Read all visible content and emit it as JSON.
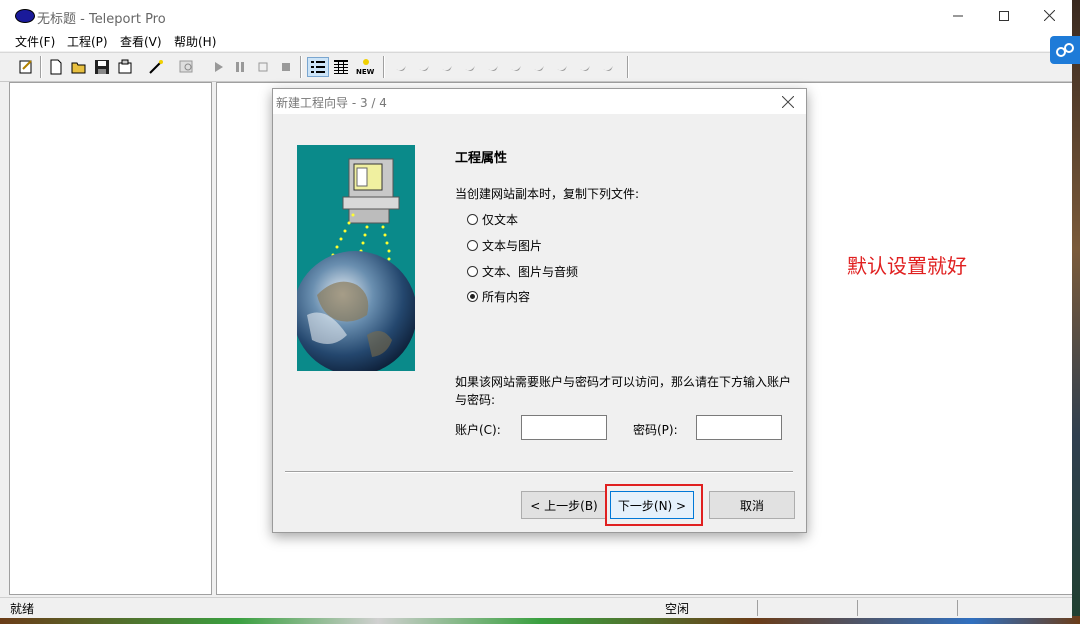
{
  "window": {
    "title": "无标题 - Teleport Pro"
  },
  "menu": {
    "file": "文件(F)",
    "project": "工程(P)",
    "view": "查看(V)",
    "help": "帮助(H)"
  },
  "toolbar": {
    "new_label": "NEW"
  },
  "status": {
    "left": "就绪",
    "idle": "空闲"
  },
  "annotation": "默认设置就好",
  "dialog": {
    "title": "新建工程向导 - 3 / 4",
    "heading": "工程属性",
    "prompt": "当创建网站副本时，复制下列文件:",
    "options": [
      "仅文本",
      "文本与图片",
      "文本、图片与音频",
      "所有内容"
    ],
    "selected_option": "所有内容",
    "login_note": "如果该网站需要账户与密码才可以访问，那么请在下方输入账户与密码:",
    "account_label": "账户(C):",
    "password_label": "密码(P):",
    "account_value": "",
    "password_value": "",
    "back_label": "< 上一步(B)",
    "next_label": "下一步(N) >",
    "cancel_label": "取消"
  },
  "colors": {
    "accent": "#0078d7",
    "annotation": "#e02020",
    "wizard_image_bg": "#0a8a8a"
  }
}
